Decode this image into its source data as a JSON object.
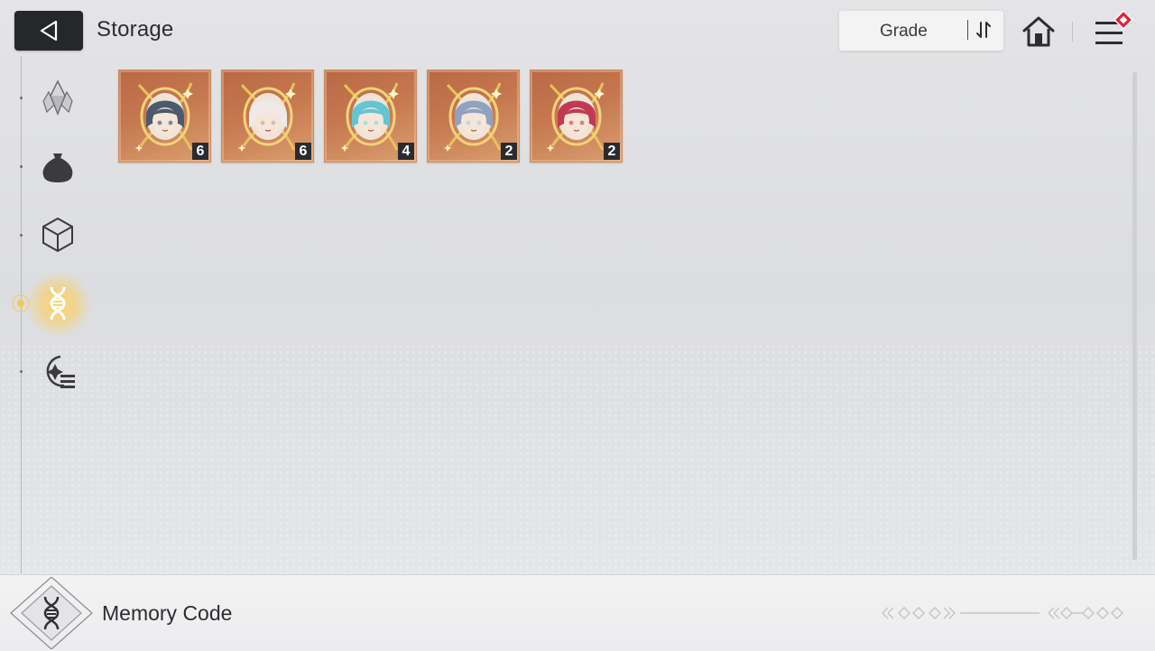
{
  "header": {
    "title": "Storage",
    "sort": {
      "label": "Grade"
    }
  },
  "sidebar": {
    "items": [
      {
        "icon": "crystal-icon"
      },
      {
        "icon": "bag-icon"
      },
      {
        "icon": "cube-icon"
      },
      {
        "icon": "memory-code-icon",
        "active": true
      },
      {
        "icon": "list-settings-icon"
      }
    ]
  },
  "items": [
    {
      "count": "6",
      "hair": "#4c5a6e",
      "accent": "#7a8ba3"
    },
    {
      "count": "6",
      "hair": "#efe9ea",
      "accent": "#c9bfc2"
    },
    {
      "count": "4",
      "hair": "#63c6d2",
      "accent": "#9fe0e6"
    },
    {
      "count": "2",
      "hair": "#8fa2c0",
      "accent": "#c7d3e6"
    },
    {
      "count": "2",
      "hair": "#c23a52",
      "accent": "#e3798d"
    }
  ],
  "footer": {
    "title": "Memory Code"
  },
  "colors": {
    "accent": "#f5c84a",
    "card": "#c6784f",
    "badge": "#e0233a",
    "dark": "#26272b"
  }
}
